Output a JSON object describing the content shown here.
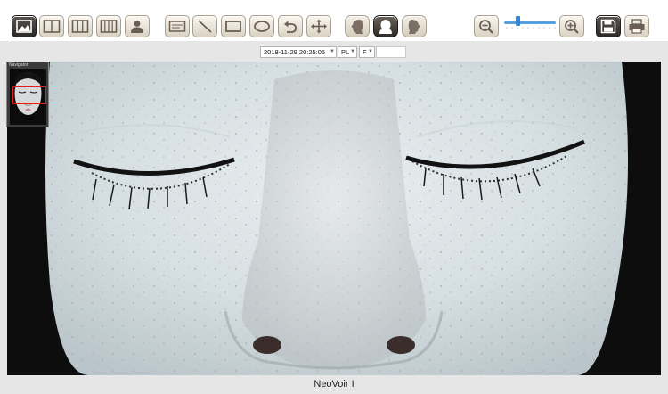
{
  "toolbar": {
    "buttons": [
      {
        "id": "layout-single",
        "icon": "image-icon"
      },
      {
        "id": "layout-two",
        "icon": "two-panel-icon"
      },
      {
        "id": "layout-three",
        "icon": "three-panel-icon"
      },
      {
        "id": "layout-four",
        "icon": "four-panel-icon"
      },
      {
        "id": "patient",
        "icon": "person-icon"
      },
      {
        "id": "text",
        "icon": "text-box-icon"
      },
      {
        "id": "line",
        "icon": "line-icon"
      },
      {
        "id": "rectangle",
        "icon": "rectangle-icon"
      },
      {
        "id": "ellipse",
        "icon": "ellipse-icon"
      },
      {
        "id": "undo",
        "icon": "undo-icon"
      },
      {
        "id": "move",
        "icon": "move-icon"
      },
      {
        "id": "face-left",
        "icon": "face-left-icon"
      },
      {
        "id": "face-front",
        "icon": "face-front-icon"
      },
      {
        "id": "face-right",
        "icon": "face-right-icon"
      },
      {
        "id": "zoom-out",
        "icon": "zoom-out-icon"
      },
      {
        "id": "zoom-in",
        "icon": "zoom-in-icon"
      },
      {
        "id": "save",
        "icon": "save-icon"
      },
      {
        "id": "print",
        "icon": "print-icon"
      }
    ],
    "zoom_level": 0.25,
    "colors": {
      "active": "#2c2926",
      "slider": "#2f86d8"
    }
  },
  "selectors": {
    "date": "2018-11-29 20:25:05",
    "mode": "PL",
    "view": "F"
  },
  "navigator": {
    "title": "Navigator"
  },
  "footer": {
    "product_name": "NeoVoir I"
  }
}
